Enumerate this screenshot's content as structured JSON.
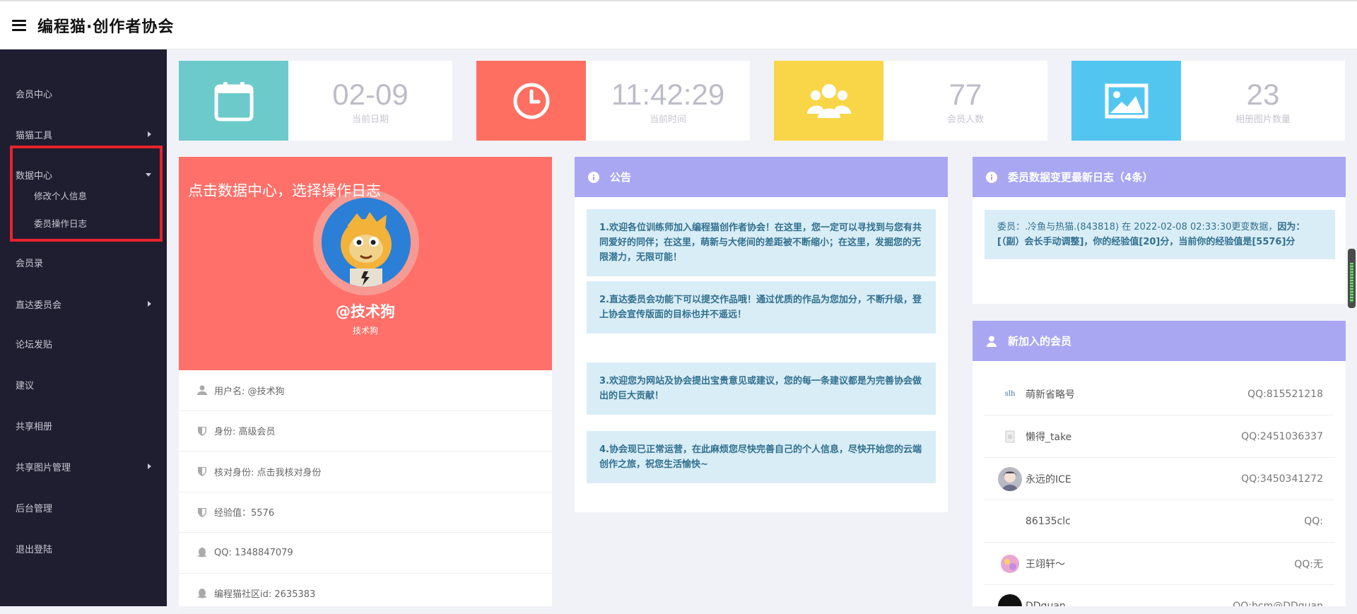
{
  "header": {
    "brand": "编程猫·创作者协会"
  },
  "sidebar": {
    "items": [
      {
        "label": "会员中心"
      },
      {
        "label": "猫猫工具"
      },
      {
        "label": "数据中心"
      },
      {
        "label": "会员录"
      },
      {
        "label": "直达委员会"
      },
      {
        "label": "论坛发贴"
      },
      {
        "label": "建议"
      },
      {
        "label": "共享相册"
      },
      {
        "label": "共享图片管理"
      },
      {
        "label": "后台管理"
      },
      {
        "label": "退出登陆"
      }
    ],
    "sub_items": [
      {
        "label": "修改个人信息"
      },
      {
        "label": "委员操作日志"
      }
    ]
  },
  "stats": [
    {
      "value": "02-09",
      "label": "当前日期",
      "color": "#6ccaca",
      "icon": "calendar-icon"
    },
    {
      "value": "11:42:29",
      "label": "当前时间",
      "color": "#fe6f61",
      "icon": "clock-icon"
    },
    {
      "value": "77",
      "label": "会员人数",
      "color": "#f9d648",
      "icon": "users-icon"
    },
    {
      "value": "23",
      "label": "相册图片数量",
      "color": "#53c6f0",
      "icon": "image-icon"
    }
  ],
  "profile": {
    "hint": "点击数据中心，选择操作日志",
    "name": "@技术狗",
    "subname": "技术狗",
    "rows": [
      {
        "text": "用户名: @技术狗",
        "icon": "user-icon"
      },
      {
        "text": "身份: 高级会员",
        "icon": "shield-icon"
      },
      {
        "text": "核对身份: 点击我核对身份",
        "icon": "shield-icon"
      },
      {
        "text": "经验值：5576",
        "icon": "shield-icon"
      },
      {
        "text": "QQ: 1348847079",
        "icon": "qq-icon"
      },
      {
        "text": "编程猫社区id: 2635383",
        "icon": "qq-icon"
      }
    ]
  },
  "notice": {
    "title": "公告",
    "items": [
      "1.欢迎各位训练师加入编程猫创作者协会！在这里，您一定可以寻找到与您有共同爱好的同伴；在这里，萌新与大佬间的差距被不断缩小；在这里，发掘您的无限潜力，无限可能！",
      "2.直达委员会功能下可以提交作品哦！通过优质的作品为您加分，不断升级，登上协会宣传版面的目标也并不遥远！",
      "3.欢迎您为网站及协会提出宝贵意见或建议，您的每一条建议都是为完善协会做出的巨大贡献！",
      "4.协会现已正常运营，在此麻烦您尽快完善自己的个人信息，尽快开始您的云端创作之旅，祝您生活愉快~"
    ]
  },
  "log": {
    "title": "委员数据变更最新日志（4条）",
    "entry_plain": "委员：.冷鱼与热猫.(843818) 在 2022-02-08 02:33:30更变数据，",
    "entry_bold": "因为：[（副）会长手动调整]，你的经验值[20]分，当前你的经验值是[5576]分"
  },
  "members": {
    "title": "新加入的会员",
    "items": [
      {
        "name": "萌新省略号",
        "qq": "QQ:815521218",
        "avatar": "slh"
      },
      {
        "name": "懒得_take",
        "qq": "QQ:2451036337",
        "avatar": ""
      },
      {
        "name": "永远的ICE",
        "qq": "QQ:3450341272",
        "avatar": ""
      },
      {
        "name": "86135clc",
        "qq": "QQ:",
        "avatar": ""
      },
      {
        "name": "王翊轩～",
        "qq": "QQ:无",
        "avatar": ""
      },
      {
        "name": "DDguan",
        "qq": "QQ:bcm@DDguan",
        "avatar": ""
      }
    ]
  }
}
